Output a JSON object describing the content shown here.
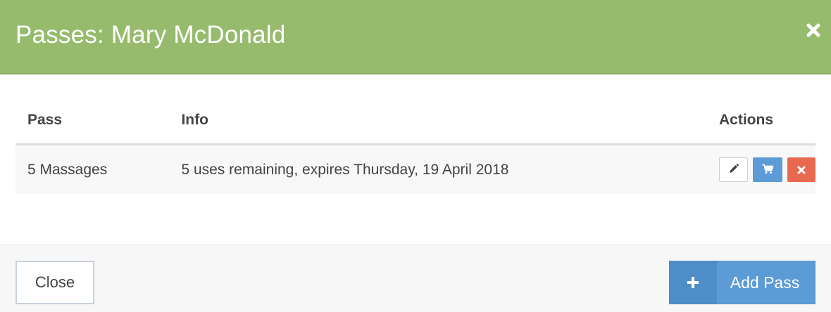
{
  "modal": {
    "title": "Passes: Mary McDonald"
  },
  "table": {
    "headers": {
      "pass": "Pass",
      "info": "Info",
      "actions": "Actions"
    },
    "rows": [
      {
        "pass": "5 Massages",
        "info": "5 uses remaining, expires Thursday, 19 April 2018"
      }
    ]
  },
  "footer": {
    "close_label": "Close",
    "add_label": "Add Pass"
  },
  "icons": {
    "close": "close-icon",
    "edit": "pencil-icon",
    "cart": "cart-icon",
    "delete": "x-icon",
    "add": "plus-icon"
  },
  "colors": {
    "header": "#97bb6d",
    "primary": "#5c9bd6",
    "primary_dark": "#4f8dc9",
    "danger": "#e8694f"
  }
}
